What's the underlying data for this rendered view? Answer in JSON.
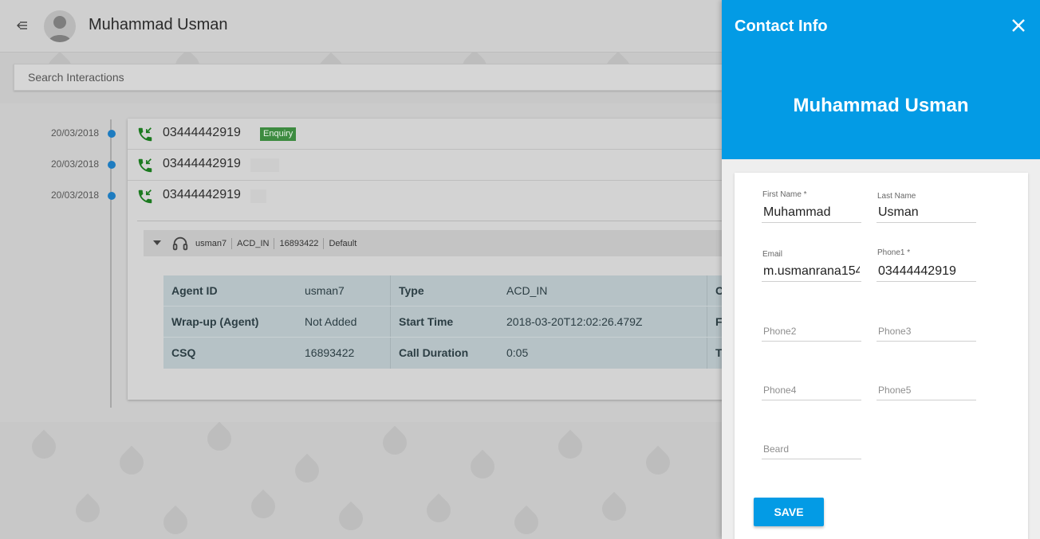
{
  "header": {
    "contact_name": "Muhammad Usman"
  },
  "search": {
    "placeholder": "Search Interactions"
  },
  "timeline": {
    "entries": [
      {
        "date": "20/03/2018",
        "number": "03444442919",
        "tag": "Enquiry"
      },
      {
        "date": "20/03/2018",
        "number": "03444442919",
        "tag": ""
      },
      {
        "date": "20/03/2018",
        "number": "03444442919",
        "tag": ""
      }
    ],
    "sub_bar": {
      "agent": "usman7",
      "type": "ACD_IN",
      "csq": "16893422",
      "queue": "Default"
    },
    "details": {
      "rows": [
        {
          "k1": "Agent ID",
          "v1": "usman7",
          "k2": "Type",
          "v2": "ACD_IN",
          "k3": "C"
        },
        {
          "k1": "Wrap-up (Agent)",
          "v1": "Not Added",
          "k2": "Start Time",
          "v2": "2018-03-20T12:02:26.479Z",
          "k3": "F"
        },
        {
          "k1": "CSQ",
          "v1": "16893422",
          "k2": "Call Duration",
          "v2": "0:05",
          "k3": "T"
        }
      ]
    }
  },
  "panel": {
    "title": "Contact Info",
    "name": "Muhammad Usman",
    "fields": {
      "first_name": {
        "label": "First Name *",
        "value": "Muhammad"
      },
      "last_name": {
        "label": "Last Name",
        "value": "Usman"
      },
      "email": {
        "label": "Email",
        "value": "m.usmanrana154"
      },
      "phone1": {
        "label": "Phone1 *",
        "value": "03444442919"
      },
      "phone2": {
        "placeholder": "Phone2"
      },
      "phone3": {
        "placeholder": "Phone3"
      },
      "phone4": {
        "placeholder": "Phone4"
      },
      "phone5": {
        "placeholder": "Phone5"
      },
      "beard": {
        "placeholder": "Beard"
      }
    },
    "save_label": "SAVE"
  },
  "colors": {
    "accent": "#039be5",
    "tag_green": "#3d8b40",
    "timeline_dot": "#1e7cc0",
    "phone_icon": "#1b7a1f"
  }
}
